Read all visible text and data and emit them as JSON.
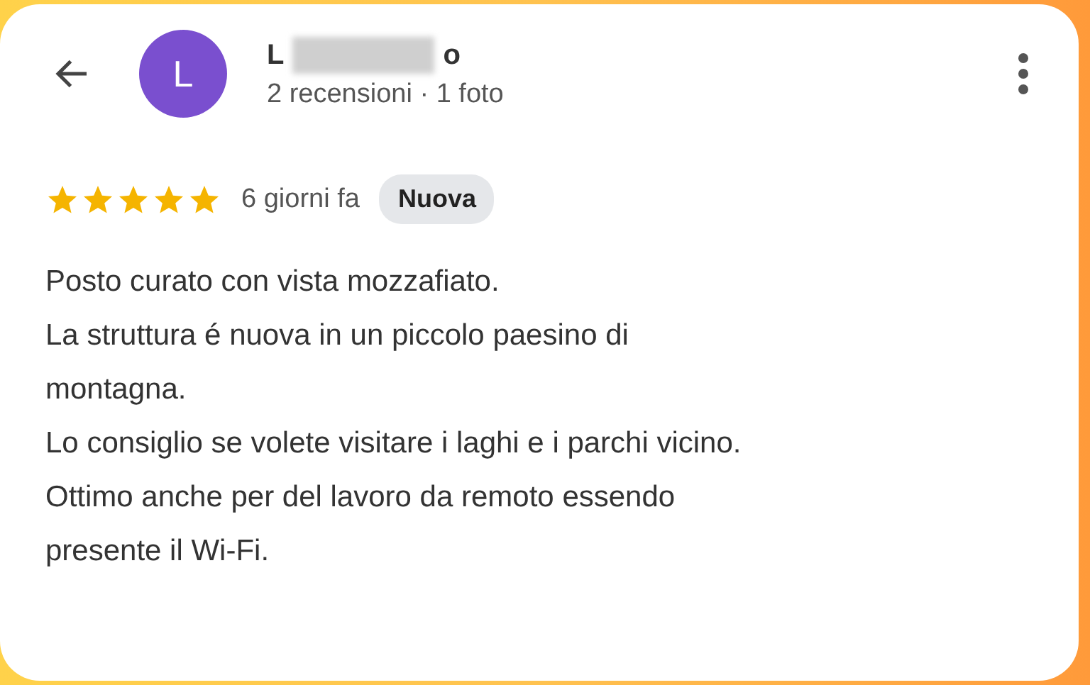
{
  "header": {
    "avatar_letter": "L",
    "name_start": "L",
    "name_end": "o",
    "meta": "2 recensioni · 1 foto"
  },
  "review": {
    "stars": 5,
    "time": "6 giorni fa",
    "badge": "Nuova",
    "lines": [
      "Posto curato con vista mozzafiato.",
      "La struttura é nuova in un piccolo paesino di",
      "montagna.",
      "Lo consiglio se volete visitare i laghi e i parchi vicino.",
      "Ottimo anche per del lavoro da remoto essendo",
      "presente il Wi-Fi."
    ]
  }
}
